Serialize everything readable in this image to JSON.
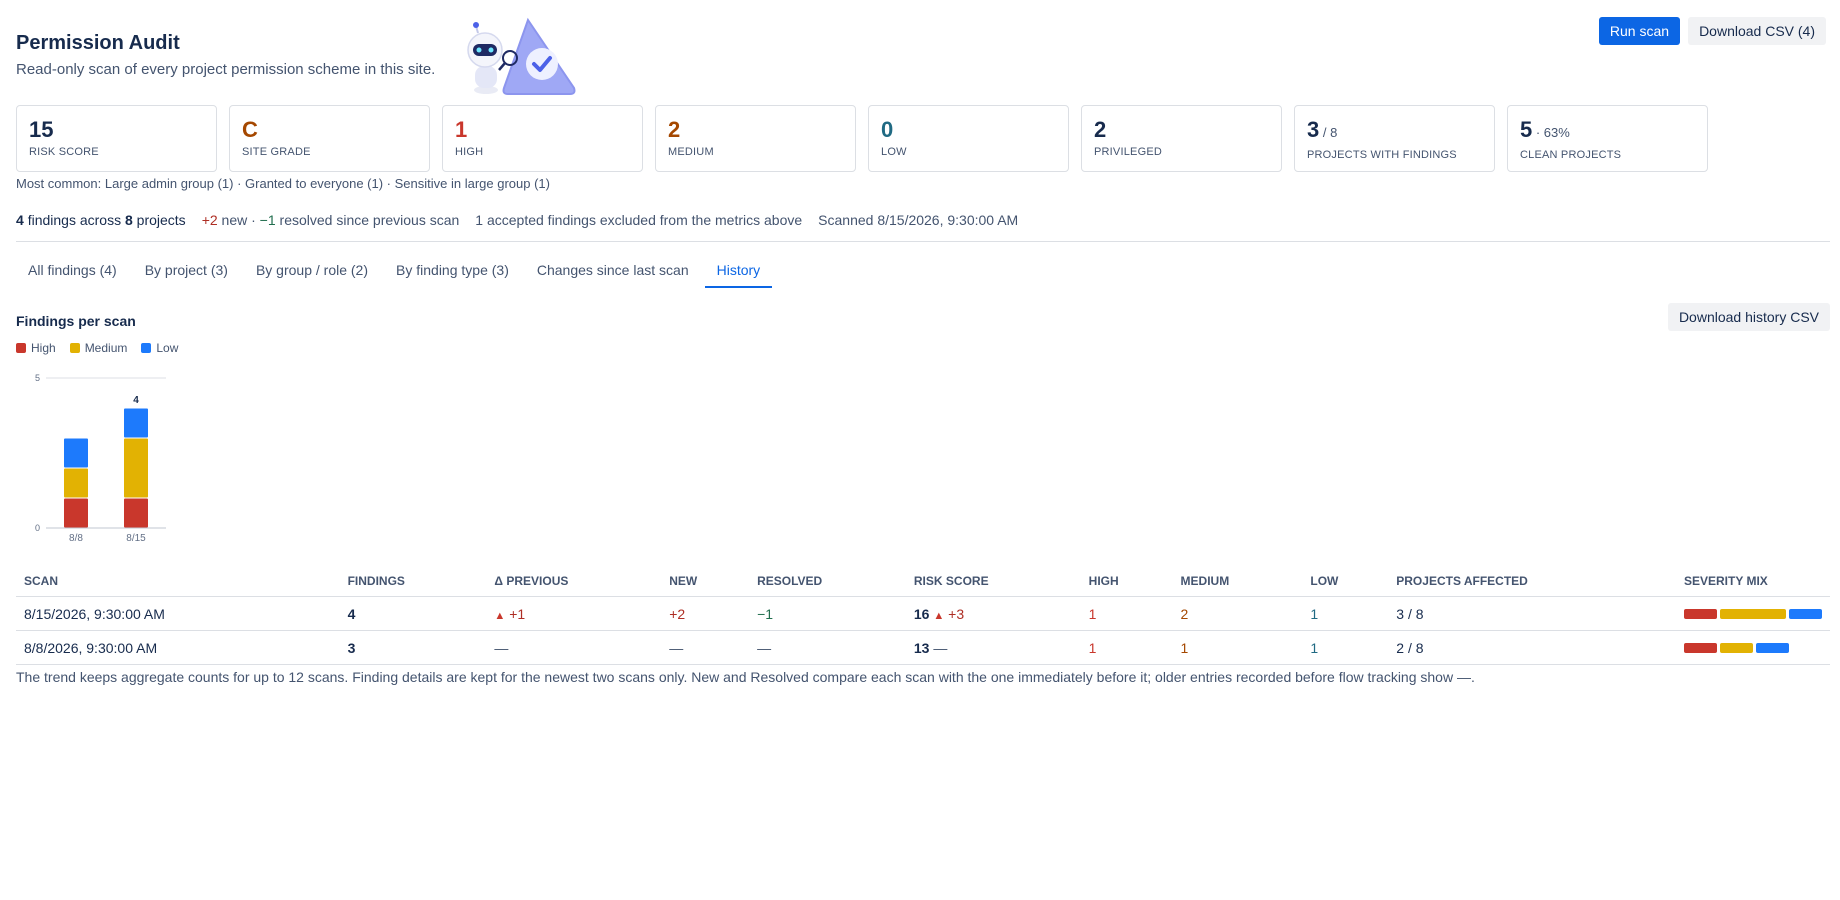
{
  "header": {
    "title": "Permission Audit",
    "subtitle": "Read-only scan of every project permission scheme in this site.",
    "run_scan": "Run scan",
    "download_csv": "Download CSV (4)"
  },
  "cards": [
    {
      "value": "15",
      "suffix": "",
      "label": "Risk score",
      "color": "#172b4d"
    },
    {
      "value": "C",
      "suffix": "",
      "label": "Site grade",
      "color": "#a54800"
    },
    {
      "value": "1",
      "suffix": "",
      "label": "High",
      "color": "#c9372c"
    },
    {
      "value": "2",
      "suffix": "",
      "label": "Medium",
      "color": "#a54800"
    },
    {
      "value": "0",
      "suffix": "",
      "label": "Low",
      "color": "#206a83"
    },
    {
      "value": "2",
      "suffix": "",
      "label": "Privileged",
      "color": "#172b4d"
    },
    {
      "value": "3",
      "suffix": " / 8",
      "label": "Projects with findings",
      "color": "#172b4d"
    },
    {
      "value": "5",
      "suffix": " · 63%",
      "label": "Clean projects",
      "color": "#172b4d"
    }
  ],
  "most_common": "Most common: Large admin group (1) · Granted to everyone (1) · Sensitive in large group (1)",
  "summary": {
    "findings_count": "4",
    "findings_text": "findings across",
    "projects_count": "8",
    "projects_text": "projects",
    "new_value": "+2",
    "new_text": "new ·",
    "resolved_value": "−1",
    "resolved_text": "resolved since previous scan",
    "accepted": "1 accepted findings excluded from the metrics above",
    "scanned": "Scanned 8/15/2026, 9:30:00 AM"
  },
  "tabs": [
    {
      "label": "All findings (4)",
      "active": false
    },
    {
      "label": "By project (3)",
      "active": false
    },
    {
      "label": "By group / role (2)",
      "active": false
    },
    {
      "label": "By finding type (3)",
      "active": false
    },
    {
      "label": "Changes since last scan",
      "active": false
    },
    {
      "label": "History",
      "active": true
    }
  ],
  "history": {
    "title": "Findings per scan",
    "download_btn": "Download history CSV",
    "legend": [
      {
        "name": "High",
        "color": "#c9372c"
      },
      {
        "name": "Medium",
        "color": "#e2b203"
      },
      {
        "name": "Low",
        "color": "#1d7afc"
      }
    ]
  },
  "chart_data": {
    "type": "bar",
    "stacked": true,
    "categories": [
      "8/8",
      "8/15"
    ],
    "series": [
      {
        "name": "High",
        "values": [
          1,
          1
        ],
        "color": "#c9372c"
      },
      {
        "name": "Medium",
        "values": [
          1,
          2
        ],
        "color": "#e2b203"
      },
      {
        "name": "Low",
        "values": [
          1,
          1
        ],
        "color": "#1d7afc"
      }
    ],
    "totals_label": [
      "",
      "4"
    ],
    "ylim": [
      0,
      5
    ],
    "yticks": [
      "0",
      "5"
    ],
    "title": "",
    "xlabel": "",
    "ylabel": ""
  },
  "table": {
    "columns": [
      "Scan",
      "Findings",
      "Δ previous",
      "New",
      "Resolved",
      "Risk score",
      "High",
      "Medium",
      "Low",
      "Projects affected",
      "Severity mix"
    ],
    "rows": [
      {
        "scan": "8/15/2026, 9:30:00 AM",
        "findings": "4",
        "delta": "+1",
        "delta_up": true,
        "new": "+2",
        "resolved": "−1",
        "risk": "16",
        "risk_delta": "+3",
        "risk_up": true,
        "high": "1",
        "medium": "2",
        "low": "1",
        "projects": "3 / 8",
        "mix": [
          1,
          2,
          1
        ]
      },
      {
        "scan": "8/8/2026, 9:30:00 AM",
        "findings": "3",
        "delta": "—",
        "delta_up": false,
        "new": "—",
        "resolved": "—",
        "risk": "13",
        "risk_delta": "—",
        "risk_up": false,
        "high": "1",
        "medium": "1",
        "low": "1",
        "projects": "2 / 8",
        "mix": [
          1,
          1,
          1
        ]
      }
    ]
  },
  "footnote": "The trend keeps aggregate counts for up to 12 scans. Finding details are kept for the newest two scans only. New and Resolved compare each scan with the one immediately before it; older entries recorded before flow tracking show —."
}
